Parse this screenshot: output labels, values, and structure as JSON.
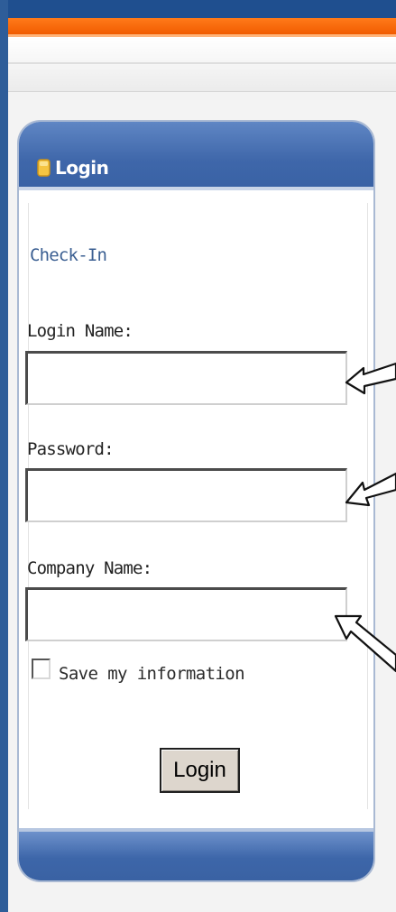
{
  "colors": {
    "accent_orange": "#f15c00",
    "panel_blue": "#3f67aa",
    "checkin_text": "#3b5f92"
  },
  "icons": {
    "login_icon": "lock-icon",
    "pointer": "arrow-icon"
  },
  "panel": {
    "title": "Login"
  },
  "form": {
    "heading": "Check-In",
    "login_name_label": "Login Name:",
    "login_name_value": "",
    "password_label": "Password:",
    "password_value": "",
    "company_name_label": "Company Name:",
    "company_name_value": "",
    "save_label": "Save my information",
    "save_checked": false,
    "login_button": "Login"
  }
}
